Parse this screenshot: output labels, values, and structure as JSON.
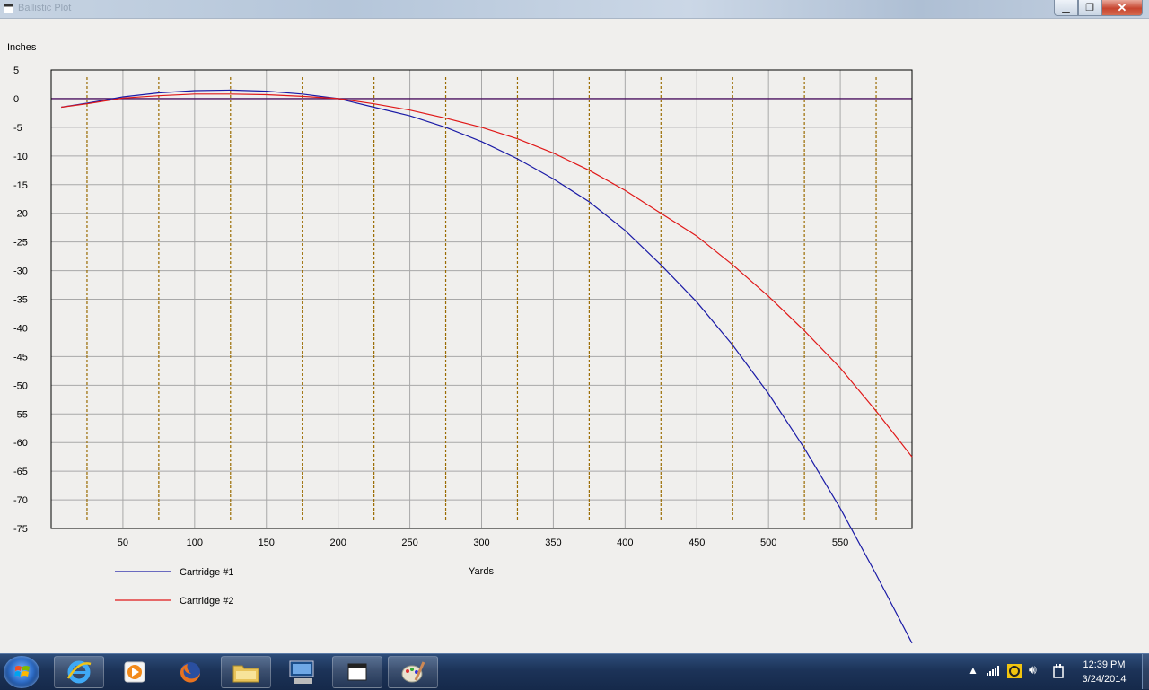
{
  "window": {
    "title": "Ballistic Plot",
    "minimize_icon": "minimize-icon",
    "maximize_icon": "restore-icon",
    "close_icon": "close-icon"
  },
  "chart_data": {
    "type": "line",
    "ylabel": "Inches",
    "xlabel": "Yards",
    "xlim": [
      0,
      600
    ],
    "ylim": [
      -75,
      5
    ],
    "x_ticks": [
      50,
      100,
      150,
      200,
      250,
      300,
      350,
      400,
      450,
      500,
      550
    ],
    "y_ticks": [
      5,
      0,
      -5,
      -10,
      -15,
      -20,
      -25,
      -30,
      -35,
      -40,
      -45,
      -50,
      -55,
      -60,
      -65,
      -70,
      -75
    ],
    "grid": true,
    "legend_position": "bottom-left",
    "series": [
      {
        "name": "Cartridge #1",
        "color": "#1a1aa6",
        "x": [
          7,
          25,
          50,
          75,
          100,
          125,
          150,
          175,
          200,
          225,
          250,
          275,
          300,
          325,
          350,
          375,
          400,
          425,
          450,
          475,
          500,
          525,
          550,
          575,
          600
        ],
        "y": [
          -1.5,
          -0.8,
          0.3,
          1.0,
          1.4,
          1.5,
          1.3,
          0.8,
          0,
          -1.5,
          -3.0,
          -5.0,
          -7.5,
          -10.5,
          -14,
          -18,
          -23,
          -29,
          -35.5,
          -43,
          -51.5,
          -61,
          -71.5,
          -83,
          -95
        ]
      },
      {
        "name": "Cartridge #2",
        "color": "#e01818",
        "x": [
          7,
          25,
          50,
          75,
          100,
          125,
          150,
          175,
          200,
          225,
          250,
          275,
          300,
          325,
          350,
          375,
          400,
          425,
          450,
          475,
          500,
          525,
          550,
          575,
          600
        ],
        "y": [
          -1.5,
          -0.9,
          0.1,
          0.5,
          0.8,
          0.8,
          0.7,
          0.4,
          0,
          -0.9,
          -2.0,
          -3.4,
          -5.0,
          -7.0,
          -9.5,
          -12.5,
          -16,
          -20,
          -24,
          -29,
          -34.5,
          -40.5,
          -47,
          -54.5,
          -62.5
        ]
      }
    ],
    "reference_lines": {
      "zero_line_color": "#4a1060",
      "dashed_x": [
        25,
        75,
        125,
        175,
        225,
        275,
        325,
        375,
        425,
        475,
        525,
        575
      ],
      "dashed_color": "#9a6b00"
    }
  },
  "taskbar": {
    "start_icon": "windows-start-icon",
    "apps": [
      "internet-explorer-icon",
      "media-player-icon",
      "firefox-icon",
      "file-explorer-icon",
      "remote-desktop-icon",
      "window-icon",
      "paint-icon"
    ],
    "tray": [
      "show-hidden-icons-arrow",
      "network-signal-icon",
      "app-tray-icon",
      "volume-icon",
      "power-icon"
    ],
    "time": "12:39 PM",
    "date": "3/24/2014"
  }
}
